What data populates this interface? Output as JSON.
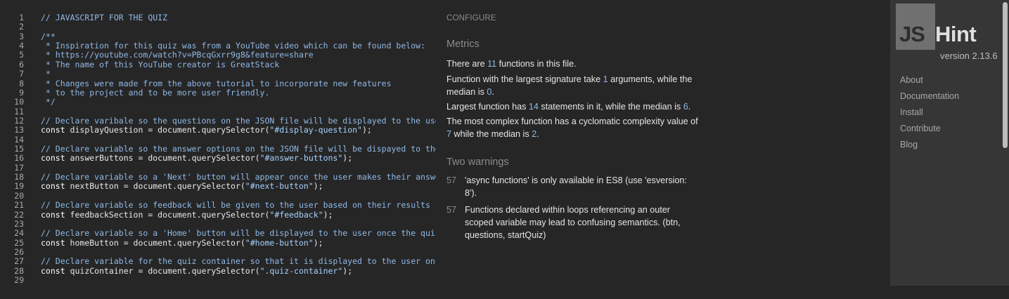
{
  "editor": {
    "lines": [
      {
        "n": "1",
        "parts": [
          {
            "t": "comment",
            "s": "// JAVASCRIPT FOR THE QUIZ"
          }
        ]
      },
      {
        "n": "2",
        "parts": []
      },
      {
        "n": "3",
        "parts": [
          {
            "t": "comment",
            "s": "/**"
          }
        ]
      },
      {
        "n": "4",
        "parts": [
          {
            "t": "comment",
            "s": " * Inspiration for this quiz was from a YouTube video which can be found below:"
          }
        ]
      },
      {
        "n": "5",
        "parts": [
          {
            "t": "comment",
            "s": " * https://youtube.com/watch?v=PBcqGxrr9g8&feature=share"
          }
        ]
      },
      {
        "n": "6",
        "parts": [
          {
            "t": "comment",
            "s": " * The name of this YouTube creator is GreatStack"
          }
        ]
      },
      {
        "n": "7",
        "parts": [
          {
            "t": "comment",
            "s": " *"
          }
        ]
      },
      {
        "n": "8",
        "parts": [
          {
            "t": "comment",
            "s": " * Changes were made from the above tutorial to incorporate new features"
          }
        ]
      },
      {
        "n": "9",
        "parts": [
          {
            "t": "comment",
            "s": " * to the project and to be more user friendly."
          }
        ]
      },
      {
        "n": "10",
        "parts": [
          {
            "t": "comment",
            "s": " */"
          }
        ]
      },
      {
        "n": "11",
        "parts": []
      },
      {
        "n": "12",
        "parts": [
          {
            "t": "comment",
            "s": "// Declare varibale so the questions on the JSON file will be displayed to the user"
          }
        ]
      },
      {
        "n": "13",
        "parts": [
          {
            "t": "kw",
            "s": "const "
          },
          {
            "t": "plain",
            "s": "displayQuestion = document.querySelector("
          },
          {
            "t": "str",
            "s": "\"#display-question\""
          },
          {
            "t": "plain",
            "s": ");"
          }
        ]
      },
      {
        "n": "14",
        "parts": []
      },
      {
        "n": "15",
        "parts": [
          {
            "t": "comment",
            "s": "// Declare variable so the answer options on the JSON file will be dispayed to the"
          }
        ]
      },
      {
        "n": "16",
        "parts": [
          {
            "t": "kw",
            "s": "const "
          },
          {
            "t": "plain",
            "s": "answerButtons = document.querySelector("
          },
          {
            "t": "str",
            "s": "\"#answer-buttons\""
          },
          {
            "t": "plain",
            "s": ");"
          }
        ]
      },
      {
        "n": "17",
        "parts": []
      },
      {
        "n": "18",
        "parts": [
          {
            "t": "comment",
            "s": "// Declare variable so a 'Next' button will appear once the user makes their answer"
          }
        ]
      },
      {
        "n": "19",
        "parts": [
          {
            "t": "kw",
            "s": "const "
          },
          {
            "t": "plain",
            "s": "nextButton = document.querySelector("
          },
          {
            "t": "str",
            "s": "\"#next-button\""
          },
          {
            "t": "plain",
            "s": ");"
          }
        ]
      },
      {
        "n": "20",
        "parts": []
      },
      {
        "n": "21",
        "parts": [
          {
            "t": "comment",
            "s": "// Declare variable so feedback will be given to the user based on their results"
          }
        ]
      },
      {
        "n": "22",
        "parts": [
          {
            "t": "kw",
            "s": "const "
          },
          {
            "t": "plain",
            "s": "feedbackSection = document.querySelector("
          },
          {
            "t": "str",
            "s": "\"#feedback\""
          },
          {
            "t": "plain",
            "s": ");"
          }
        ]
      },
      {
        "n": "23",
        "parts": []
      },
      {
        "n": "24",
        "parts": [
          {
            "t": "comment",
            "s": "// Declare variable so a 'Home' button will be displayed to the user once the quiz"
          }
        ]
      },
      {
        "n": "25",
        "parts": [
          {
            "t": "kw",
            "s": "const "
          },
          {
            "t": "plain",
            "s": "homeButton = document.querySelector("
          },
          {
            "t": "str",
            "s": "\"#home-button\""
          },
          {
            "t": "plain",
            "s": ");"
          }
        ]
      },
      {
        "n": "26",
        "parts": []
      },
      {
        "n": "27",
        "parts": [
          {
            "t": "comment",
            "s": "// Declare variable for the quiz container so that it is displayed to the user once"
          }
        ]
      },
      {
        "n": "28",
        "parts": [
          {
            "t": "kw",
            "s": "const "
          },
          {
            "t": "plain",
            "s": "quizContainer = document.querySelector("
          },
          {
            "t": "str",
            "s": "\".quiz-container\""
          },
          {
            "t": "plain",
            "s": ");"
          }
        ]
      },
      {
        "n": "29",
        "parts": []
      }
    ]
  },
  "report": {
    "configure_label": "CONFIGURE",
    "metrics_heading": "Metrics",
    "metrics": {
      "p1": {
        "a": "There are ",
        "n1": "11",
        "b": " functions in this file."
      },
      "p2": {
        "a": "Function with the largest signature take ",
        "n1": "1",
        "b": " arguments, while the median is ",
        "n2": "0",
        "c": "."
      },
      "p3": {
        "a": "Largest function has ",
        "n1": "14",
        "b": " statements in it, while the median is ",
        "n2": "6",
        "c": "."
      },
      "p4": {
        "a": "The most complex function has a cyclomatic complexity value of ",
        "n1": "7",
        "b": " while the median is ",
        "n2": "2",
        "c": "."
      }
    },
    "warnings_heading": "Two warnings",
    "warnings": [
      {
        "line": "57",
        "text": "'async functions' is only available in ES8 (use 'esversion: 8')."
      },
      {
        "line": "57",
        "text": "Functions declared within loops referencing an outer scoped variable may lead to confusing semantics. (btn, questions, startQuiz)"
      }
    ]
  },
  "sidebar": {
    "logo_js": "JS",
    "logo_hint": "Hint",
    "version": "version 2.13.6",
    "nav": [
      "About",
      "Documentation",
      "Install",
      "Contribute",
      "Blog"
    ]
  },
  "colors": {
    "background": "#262626",
    "sidebar": "#363636",
    "accent_number": "#8fb8e6"
  }
}
